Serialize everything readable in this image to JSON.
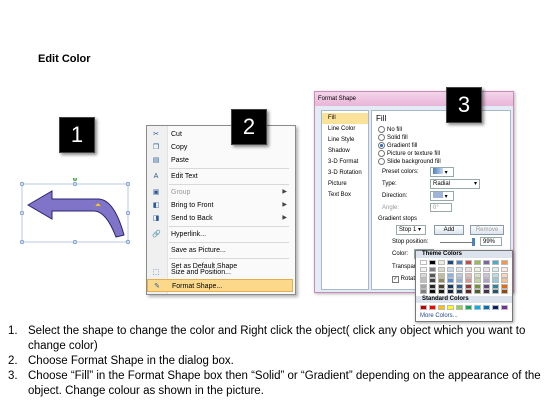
{
  "title": "Edit Color",
  "badges": [
    "1",
    "2",
    "3"
  ],
  "context_menu": {
    "items": [
      {
        "icon": "scissors-icon",
        "glyph": "✂",
        "label": "Cut",
        "arrow": false,
        "disabled": false,
        "highlight": false
      },
      {
        "icon": "copy-icon",
        "glyph": "❐",
        "label": "Copy",
        "arrow": false,
        "disabled": false,
        "highlight": false
      },
      {
        "icon": "paste-icon",
        "glyph": "▤",
        "label": "Paste",
        "arrow": false,
        "disabled": false,
        "highlight": false
      },
      {
        "icon": "edit-text-icon",
        "glyph": "A",
        "label": "Edit Text",
        "arrow": false,
        "disabled": false,
        "highlight": false
      },
      {
        "icon": "group-icon",
        "glyph": "▣",
        "label": "Group",
        "arrow": true,
        "disabled": true,
        "highlight": false
      },
      {
        "icon": "bring-to-front-icon",
        "glyph": "◧",
        "label": "Bring to Front",
        "arrow": true,
        "disabled": false,
        "highlight": false
      },
      {
        "icon": "send-to-back-icon",
        "glyph": "◨",
        "label": "Send to Back",
        "arrow": true,
        "disabled": false,
        "highlight": false
      },
      {
        "icon": "hyperlink-icon",
        "glyph": "🔗",
        "label": "Hyperlink...",
        "arrow": false,
        "disabled": false,
        "highlight": false
      },
      {
        "icon": "",
        "glyph": "",
        "label": "Save as Picture...",
        "arrow": false,
        "disabled": false,
        "highlight": false
      },
      {
        "icon": "",
        "glyph": "",
        "label": "Set as Default Shape",
        "arrow": false,
        "disabled": false,
        "highlight": false
      },
      {
        "icon": "size-position-icon",
        "glyph": "⬚",
        "label": "Size and Position...",
        "arrow": false,
        "disabled": false,
        "highlight": false
      },
      {
        "icon": "format-shape-icon",
        "glyph": "✎",
        "label": "Format Shape...",
        "arrow": false,
        "disabled": false,
        "highlight": true
      }
    ]
  },
  "format_dialog": {
    "title": "Format Shape",
    "sidebar": [
      "Fill",
      "Line Color",
      "Line Style",
      "Shadow",
      "3-D Format",
      "3-D Rotation",
      "Picture",
      "Text Box"
    ],
    "fill_heading": "Fill",
    "radios": [
      "No fill",
      "Solid fill",
      "Gradient fill",
      "Picture or texture fill",
      "Slide background fill"
    ],
    "radio_selected": 2,
    "preset_colors_label": "Preset colors:",
    "type_label": "Type:",
    "type_value": "Radial",
    "direction_label": "Direction:",
    "angle_label": "Angle:",
    "angle_value": "0°",
    "gradient_stops_label": "Gradient stops",
    "stop_value": "Stop 1",
    "add_label": "Add",
    "remove_label": "Remove",
    "stop_position_label": "Stop position:",
    "stop_position_value": "99%",
    "color_label": "Color:",
    "transparency_label": "Transpar",
    "rotate_label": "Rotate"
  },
  "color_picker": {
    "theme_label": "Theme Colors",
    "standard_label": "Standard Colors",
    "more_label": "More Colors...",
    "theme_top": [
      "#ffffff",
      "#000000",
      "#eeece1",
      "#1f497d",
      "#4f81bd",
      "#c0504d",
      "#9bbb59",
      "#8064a2",
      "#4bacc6",
      "#f79646"
    ],
    "theme_shades": [
      [
        "#f2f2f2",
        "#7f7f7f",
        "#ddd9c3",
        "#c6d9f0",
        "#dbe5f1",
        "#f2dcdb",
        "#ebf1dd",
        "#e5e0ec",
        "#dbeef3",
        "#fdeada"
      ],
      [
        "#d8d8d8",
        "#595959",
        "#c4bd97",
        "#8db3e2",
        "#b8cce4",
        "#e5b9b7",
        "#d7e3bc",
        "#ccc1d9",
        "#b7dde8",
        "#fbd5b5"
      ],
      [
        "#bfbfbf",
        "#3f3f3f",
        "#938953",
        "#548dd4",
        "#95b3d7",
        "#d99694",
        "#c3d69b",
        "#b2a2c7",
        "#92cddc",
        "#fac08f"
      ],
      [
        "#a5a5a5",
        "#262626",
        "#494429",
        "#17365d",
        "#366092",
        "#953734",
        "#76923c",
        "#5f497a",
        "#31859b",
        "#e36c09"
      ],
      [
        "#7f7f7f",
        "#0c0c0c",
        "#1d1b10",
        "#0f243e",
        "#244061",
        "#632423",
        "#4f6128",
        "#3f3151",
        "#205867",
        "#974806"
      ]
    ],
    "standard": [
      "#c00000",
      "#ff0000",
      "#ffc000",
      "#ffff00",
      "#92d050",
      "#00b050",
      "#00b0f0",
      "#0070c0",
      "#002060",
      "#7030a0"
    ]
  },
  "steps": [
    {
      "num": "1.",
      "text": "Select the shape to change the color and Right click the object( click any object which you want to change color)"
    },
    {
      "num": "2.",
      "text": "Choose Format Shape in the dialog box."
    },
    {
      "num": "3.",
      "text": "Choose “Fill” in the Format Shape box then “Solid” or “Gradient” depending on the appearance of the object. Change colour as shown in the picture."
    }
  ]
}
